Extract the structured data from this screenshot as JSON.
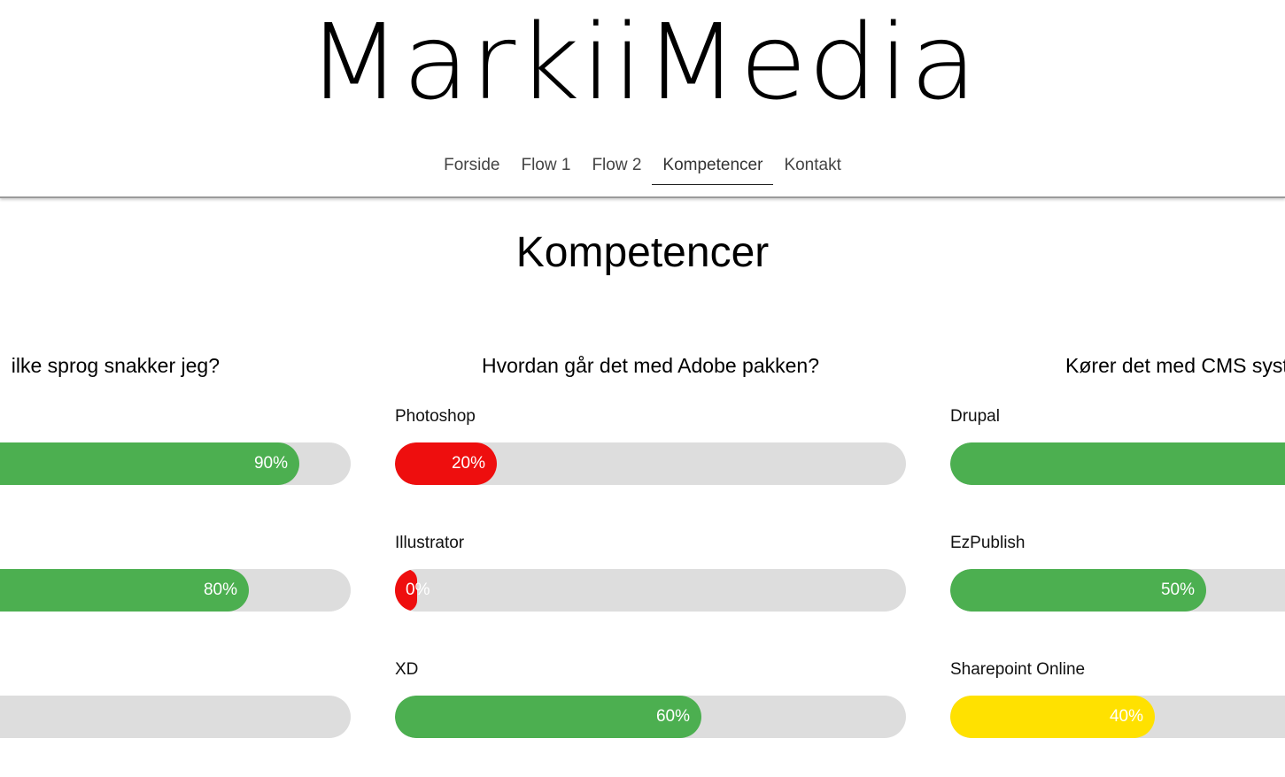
{
  "header": {
    "logo": "MarkiiMedia",
    "nav": [
      "Forside",
      "Flow 1",
      "Flow 2",
      "Kompetencer",
      "Kontakt"
    ],
    "active_nav": "Kompetencer"
  },
  "main": {
    "title": "Kompetencer",
    "columns": [
      {
        "heading": "ilke sprog snakker jeg?",
        "skills": [
          {
            "label": "",
            "percent": 90,
            "text": "90%",
            "color": "#4caf50"
          },
          {
            "label": "",
            "percent": 80,
            "text": "80%",
            "color": "#4caf50"
          },
          {
            "label": "",
            "percent": 0,
            "text": "",
            "color": "#4caf50"
          }
        ]
      },
      {
        "heading": "Hvordan går det med Adobe pakken?",
        "skills": [
          {
            "label": "Photoshop",
            "percent": 20,
            "text": "20%",
            "color": "#ee0e0e"
          },
          {
            "label": "Illustrator",
            "percent": 0,
            "text": "0%",
            "color": "#ee0e0e"
          },
          {
            "label": "XD",
            "percent": 60,
            "text": "60%",
            "color": "#4caf50"
          }
        ]
      },
      {
        "heading": "Kører det med CMS systemer?",
        "skills": [
          {
            "label": "Drupal",
            "percent": 100,
            "text": "",
            "color": "#4caf50"
          },
          {
            "label": "EzPublish",
            "percent": 50,
            "text": "50%",
            "color": "#4caf50"
          },
          {
            "label": "Sharepoint Online",
            "percent": 40,
            "text": "40%",
            "color": "#ffe100"
          }
        ]
      }
    ]
  }
}
